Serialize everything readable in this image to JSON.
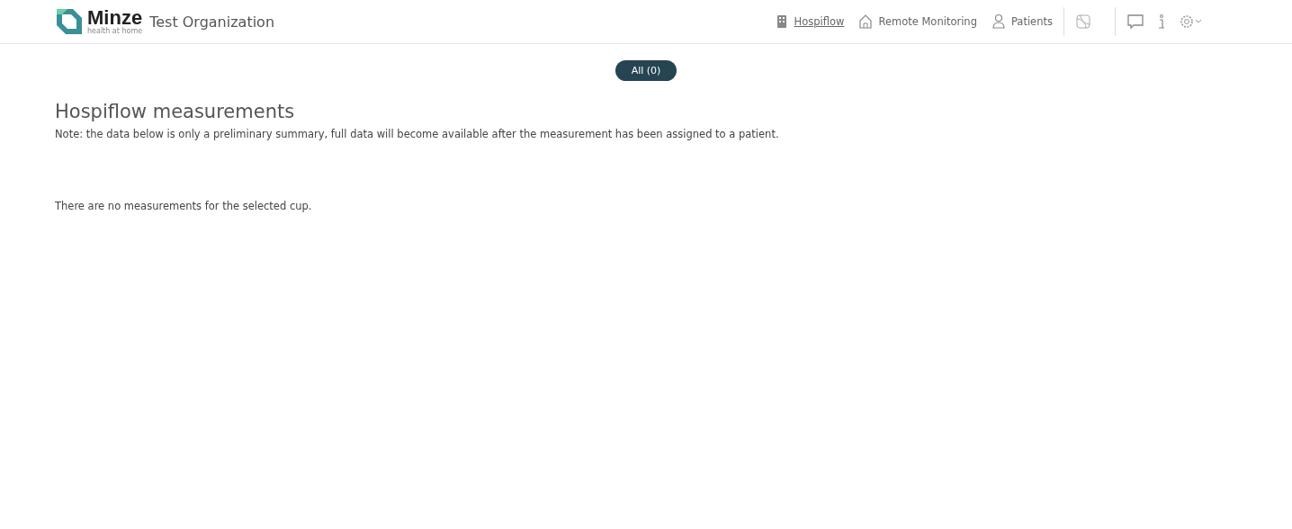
{
  "header": {
    "brand": "Minze",
    "tagline": "health at home",
    "organization": "Test Organization",
    "nav": [
      {
        "label": "Hospiflow",
        "selected": true
      },
      {
        "label": "Remote Monitoring",
        "selected": false
      },
      {
        "label": "Patients",
        "selected": false
      }
    ]
  },
  "filters": [
    {
      "label": "All (0)",
      "selected": true
    }
  ],
  "title": "Hospiflow measurements",
  "note": "Note: the data below is only a preliminary summary, full data will become available after the measurement has been assigned to a patient.",
  "empty_message": "There are no measurements for the selected cup."
}
